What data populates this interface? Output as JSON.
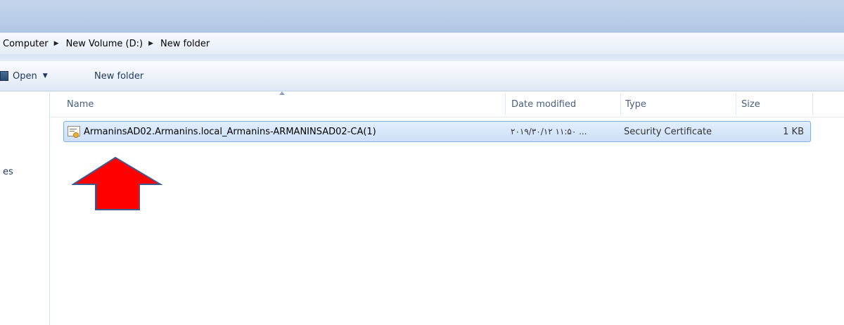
{
  "breadcrumb": {
    "items": [
      "Computer",
      "New Volume (D:)",
      "New folder"
    ]
  },
  "toolbar": {
    "open_label": "Open",
    "new_folder_label": "New folder"
  },
  "nav_pane": {
    "partial_item": "es"
  },
  "columns": {
    "name": "Name",
    "date_modified": "Date modified",
    "type": "Type",
    "size": "Size"
  },
  "files": [
    {
      "name": "ArmaninsAD02.Armanins.local_Armanins-ARMANINSAD02-CA(1)",
      "date_modified": "۲۰۱۹/۳۰/۱۲ ۱۱:۵۰ ...",
      "type": "Security Certificate",
      "size": "1 KB",
      "icon": "certificate-icon"
    }
  ],
  "annotation": {
    "shape": "up-arrow",
    "color": "#ff0000"
  },
  "colors": {
    "selection": "#cde0f7",
    "selection_border": "#84acdd",
    "titlebar": "#b9cde7"
  }
}
